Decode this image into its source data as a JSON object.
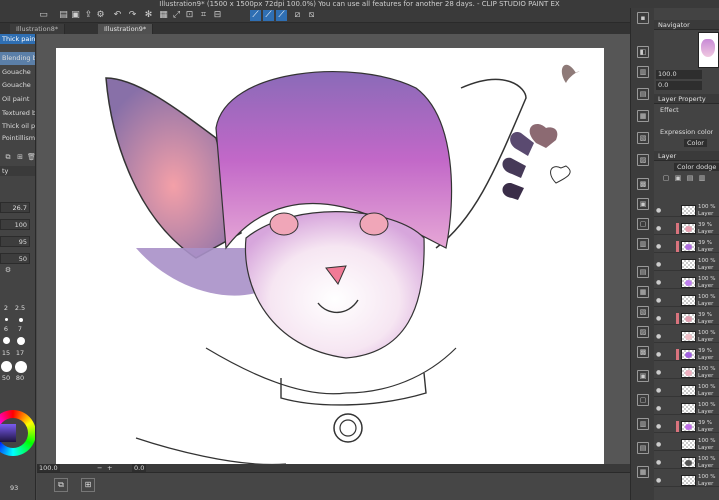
{
  "window": {
    "title": "Illustration9* (1500 x 1500px 72dpi 100.0%)  You can use all features for another 28 days. - CLIP STUDIO PAINT EX"
  },
  "tabs": [
    {
      "label": "Illustration8*"
    },
    {
      "label": "Illustration9*"
    }
  ],
  "subtool": {
    "header": "Thick paint",
    "items": [
      {
        "label": "Blending brush"
      },
      {
        "label": "Gouache"
      },
      {
        "label": "Gouache"
      },
      {
        "label": "Oil paint"
      },
      {
        "label": "Textured brush"
      },
      {
        "label": "Thick oil paint"
      },
      {
        "label": "Pointillism"
      }
    ]
  },
  "tool_property": {
    "header": "ty",
    "brush_size": "26.7",
    "opacity": "100",
    "density": "95",
    "blend": "50"
  },
  "brush_size_palette": {
    "sizes": [
      "2",
      "2.5",
      "6",
      "7",
      "15",
      "17",
      "50",
      "80"
    ]
  },
  "status": {
    "zoom": "100.0",
    "angle": "0.0",
    "color_value": "93"
  },
  "navigator": {
    "title": "Navigator",
    "zoom": "100.0",
    "angle": "0.0"
  },
  "layer_property": {
    "title": "Layer Property",
    "effect_label": "Effect",
    "expression_color_label": "Expression color",
    "color_value": "Color"
  },
  "layer_panel": {
    "title": "Layer",
    "blend_mode": "Color dodge",
    "layers": [
      {
        "opacity": "100 %",
        "name": "Layer",
        "clipped": false,
        "swatch": ""
      },
      {
        "opacity": "39 %",
        "name": "Layer",
        "clipped": true,
        "swatch": "#e8a0b0"
      },
      {
        "opacity": "39 %",
        "name": "Layer",
        "clipped": true,
        "swatch": "#b070e0"
      },
      {
        "opacity": "100 %",
        "name": "Layer",
        "clipped": false,
        "swatch": ""
      },
      {
        "opacity": "100 %",
        "name": "Layer",
        "clipped": false,
        "swatch": "#c080f0"
      },
      {
        "opacity": "100 %",
        "name": "Layer",
        "clipped": false,
        "swatch": ""
      },
      {
        "opacity": "39 %",
        "name": "Layer",
        "clipped": true,
        "swatch": "#e0a0b0"
      },
      {
        "opacity": "100 %",
        "name": "Layer",
        "clipped": false,
        "swatch": "#f0c0c8"
      },
      {
        "opacity": "39 %",
        "name": "Layer",
        "clipped": true,
        "swatch": "#a060e0"
      },
      {
        "opacity": "100 %",
        "name": "Layer",
        "clipped": false,
        "swatch": "#f0b0c0"
      },
      {
        "opacity": "100 %",
        "name": "Layer",
        "clipped": false,
        "swatch": ""
      },
      {
        "opacity": "100 %",
        "name": "Layer",
        "clipped": false,
        "swatch": ""
      },
      {
        "opacity": "39 %",
        "name": "Layer",
        "clipped": true,
        "swatch": "#c070e8"
      },
      {
        "opacity": "100 %",
        "name": "Layer",
        "clipped": false,
        "swatch": ""
      },
      {
        "opacity": "100 %",
        "name": "Layer",
        "clipped": false,
        "swatch": "#555555"
      },
      {
        "opacity": "100 %",
        "name": "Layer",
        "clipped": false,
        "swatch": ""
      }
    ]
  },
  "colors": {
    "accent": "#2f6fb3",
    "panel": "#434343",
    "clip_marker": "#d9737d"
  }
}
